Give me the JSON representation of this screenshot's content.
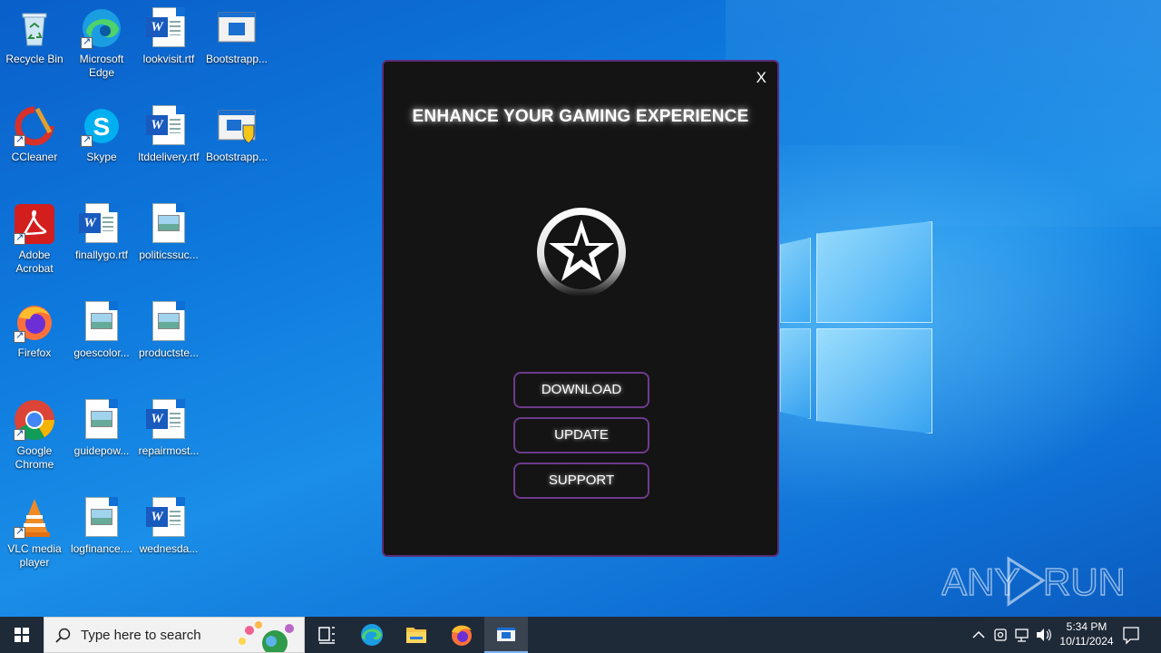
{
  "desktop": {
    "icons": [
      {
        "label": "Recycle Bin",
        "icon": "recycle-bin-icon"
      },
      {
        "label": "Microsoft Edge",
        "icon": "edge-icon"
      },
      {
        "label": "lookvisit.rtf",
        "icon": "word-doc-icon"
      },
      {
        "label": "Bootstrapp...",
        "icon": "window-app-icon"
      },
      {
        "label": "CCleaner",
        "icon": "ccleaner-icon"
      },
      {
        "label": "Skype",
        "icon": "skype-icon"
      },
      {
        "label": "ltddelivery.rtf",
        "icon": "word-doc-icon"
      },
      {
        "label": "Bootstrapp...",
        "icon": "installer-shield-icon"
      },
      {
        "label": "Adobe Acrobat",
        "icon": "acrobat-icon"
      },
      {
        "label": "finallygo.rtf",
        "icon": "word-doc-icon"
      },
      {
        "label": "politicssuc...",
        "icon": "image-file-icon"
      },
      {
        "label": "Firefox",
        "icon": "firefox-icon"
      },
      {
        "label": "goescolor...",
        "icon": "image-file-icon"
      },
      {
        "label": "productste...",
        "icon": "image-file-icon"
      },
      {
        "label": "Google Chrome",
        "icon": "chrome-icon"
      },
      {
        "label": "guidepow...",
        "icon": "image-file-icon"
      },
      {
        "label": "repairmost...",
        "icon": "word-doc-icon"
      },
      {
        "label": "VLC media player",
        "icon": "vlc-icon"
      },
      {
        "label": "logfinance....",
        "icon": "image-file-icon"
      },
      {
        "label": "wednesda...",
        "icon": "word-doc-icon"
      }
    ]
  },
  "popup": {
    "close_label": "X",
    "title": "ENHANCE YOUR GAMING EXPERIENCE",
    "buttons": {
      "download": "DOWNLOAD",
      "update": "UPDATE",
      "support": "SUPPORT"
    },
    "colors": {
      "background": "#141414",
      "border": "#5b2d78",
      "button_border": "#6d3a8c"
    }
  },
  "watermark": {
    "text_left": "ANY",
    "text_right": "RUN"
  },
  "taskbar": {
    "search_placeholder": "Type here to search",
    "clock_time": "5:34 PM",
    "clock_date": "10/11/2024"
  }
}
